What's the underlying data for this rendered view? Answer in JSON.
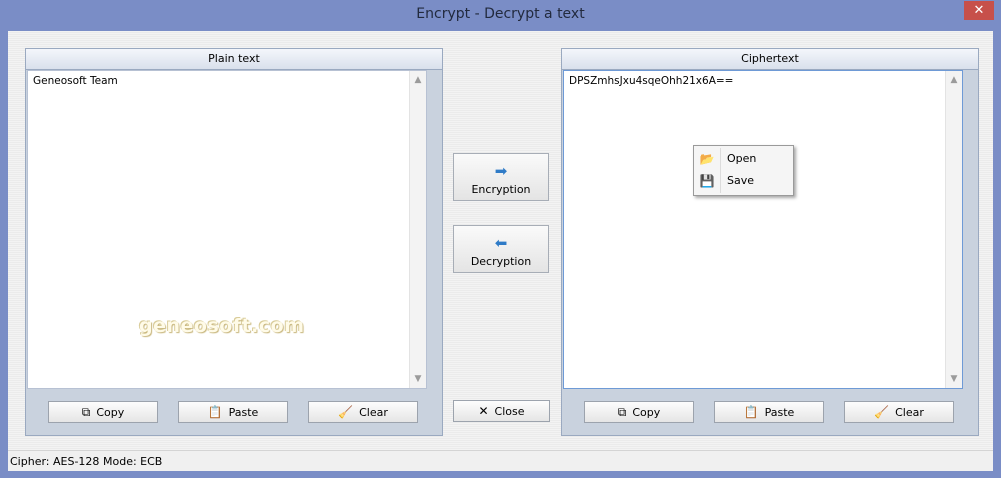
{
  "window": {
    "title": "Encrypt - Decrypt a text",
    "close_glyph": "✕"
  },
  "left_panel": {
    "header": "Plain text",
    "text": "Geneosoft Team",
    "buttons": {
      "copy": "Copy",
      "paste": "Paste",
      "clear": "Clear"
    }
  },
  "right_panel": {
    "header": "Ciphertext",
    "text": "DPSZmhsJxu4sqeOhh21x6A==",
    "buttons": {
      "copy": "Copy",
      "paste": "Paste",
      "clear": "Clear"
    }
  },
  "actions": {
    "encrypt": "Encryption",
    "decrypt": "Decryption",
    "close": "Close"
  },
  "context_menu": {
    "items": [
      {
        "label": "Open",
        "icon": "folder-open-icon"
      },
      {
        "label": "Save",
        "icon": "floppy-disk-icon"
      }
    ]
  },
  "watermark": "geneosoft.com",
  "status": {
    "cipher": "Cipher: AES-128",
    "mode": "Mode: ECB"
  },
  "icons": {
    "copy": "copy-icon",
    "paste": "paste-icon",
    "clear": "broom-icon",
    "close": "x-icon",
    "encrypt": "arrow-right-icon",
    "decrypt": "arrow-left-icon"
  },
  "colors": {
    "titlebar": "#7a8dc6",
    "close_button": "#c7504a",
    "panel_bg": "#c9d2de",
    "arrow": "#2f7bc7"
  }
}
